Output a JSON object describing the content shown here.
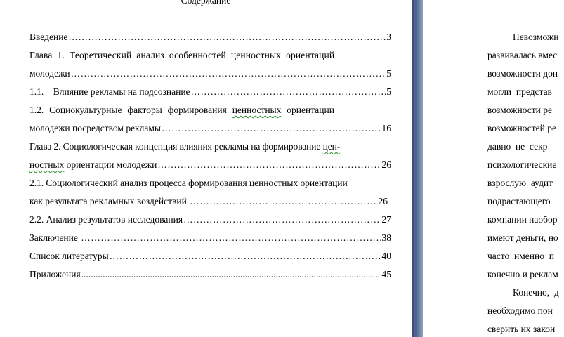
{
  "toc": {
    "heading": "Содержание",
    "entries": [
      {
        "text": "Введение ",
        "page": "3"
      },
      {
        "line1": "Глава 1. Теоретический анализ особенностей ценностных ориентаций",
        "text": "молодежи",
        "page": "5"
      },
      {
        "text": "1.1.    Влияние рекламы на подсознание",
        "page": "5"
      },
      {
        "line1_a": "1.2. Социокультурные факторы формирования ",
        "line1_b": "ценностных",
        "line1_c": " ориентации",
        "text": "молодежи посредством рекламы",
        "page": "16"
      },
      {
        "line1_a": "Глава 2. Социологическая концепция влияния рекламы на формирование ",
        "line1_b": "цен-",
        "text_a": "ностных",
        "text_b": " ориентации молодежи",
        "page": "26"
      },
      {
        "line1": "2.1. Социологический анализ процесса формирования ценностных ориентации",
        "text": "как результата рекламных воздействий ",
        "page": "26"
      },
      {
        "text": "2.2. Анализ результатов исследования",
        "page": "27"
      },
      {
        "text": "Заключение ",
        "page": "38"
      },
      {
        "text": "Список литературы",
        "page": "40"
      },
      {
        "text": "Приложения",
        "page": "45"
      }
    ]
  },
  "right_page": {
    "lines": [
      "Невозможн",
      "развивалась вмес",
      "возможности дон",
      "могли  представ",
      "возможности ре",
      "возможностей ре",
      "давно  не  секр",
      "психологические",
      "взрослую  аудит",
      "подрастающего",
      "компании наобор",
      "имеют деньги, но",
      "часто  именно  п",
      "конечно и реклам",
      "Конечно,  д",
      "необходимо пон",
      "сверить их закон"
    ]
  },
  "colors": {
    "gutter": "#4a5f88",
    "spellcheck": "#2a8a2a"
  }
}
